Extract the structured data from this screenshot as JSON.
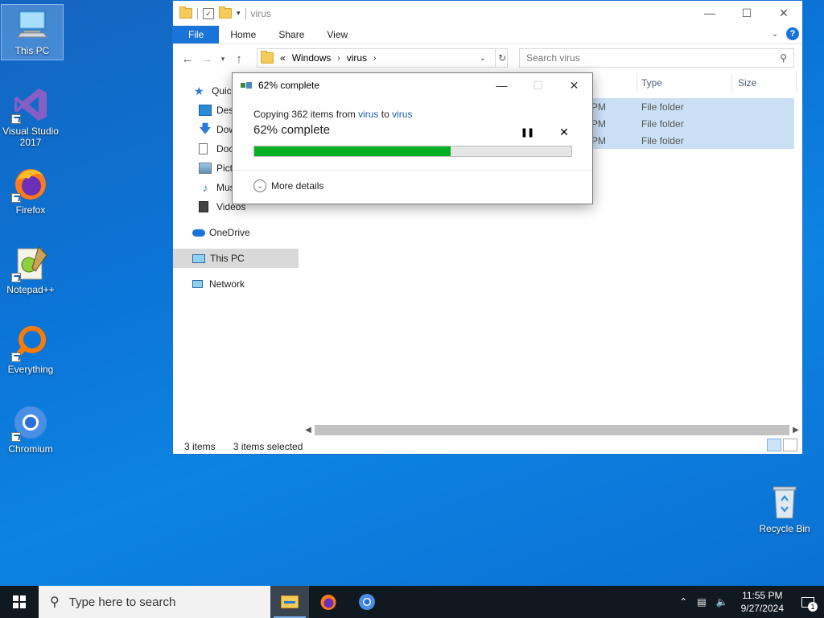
{
  "desktop": {
    "icons": [
      {
        "label": "This PC"
      },
      {
        "label": "Visual Studio 2017"
      },
      {
        "label": "Firefox"
      },
      {
        "label": "Notepad++"
      },
      {
        "label": "Everything"
      },
      {
        "label": "Chromium"
      },
      {
        "label": "Recycle Bin"
      }
    ]
  },
  "explorer": {
    "title": "virus",
    "ribbon": {
      "file": "File",
      "home": "Home",
      "share": "Share",
      "view": "View",
      "help": "?"
    },
    "address": {
      "prefix": "«",
      "crumb1": "Windows",
      "crumb2": "virus"
    },
    "search_placeholder": "Search virus",
    "nav": {
      "quick": "Quick access",
      "desktop": "Desktop",
      "downloads": "Downloads",
      "documents": "Documents",
      "pictures": "Pictures",
      "music": "Music",
      "videos": "Videos",
      "onedrive": "OneDrive",
      "thispc": "This PC",
      "network": "Network"
    },
    "columns": {
      "type": "Type",
      "size": "Size"
    },
    "rows": [
      {
        "time_suffix": "PM",
        "type": "File folder"
      },
      {
        "time_suffix": "PM",
        "type": "File folder"
      },
      {
        "time_suffix": "PM",
        "type": "File folder"
      }
    ],
    "status": {
      "count": "3 items",
      "selected": "3 items selected"
    }
  },
  "dialog": {
    "title": "62% complete",
    "copy_prefix": "Copying 362 items from ",
    "from": "virus",
    "to_word": " to ",
    "to": "virus",
    "percent_text": "62% complete",
    "progress": 0.62,
    "more_details": "More details"
  },
  "taskbar": {
    "search_placeholder": "Type here to search",
    "time": "11:55 PM",
    "date": "9/27/2024",
    "notif_count": "1"
  },
  "colors": {
    "accent": "#1a73d9",
    "progress": "#06b025",
    "selection": "#cce0f5"
  }
}
